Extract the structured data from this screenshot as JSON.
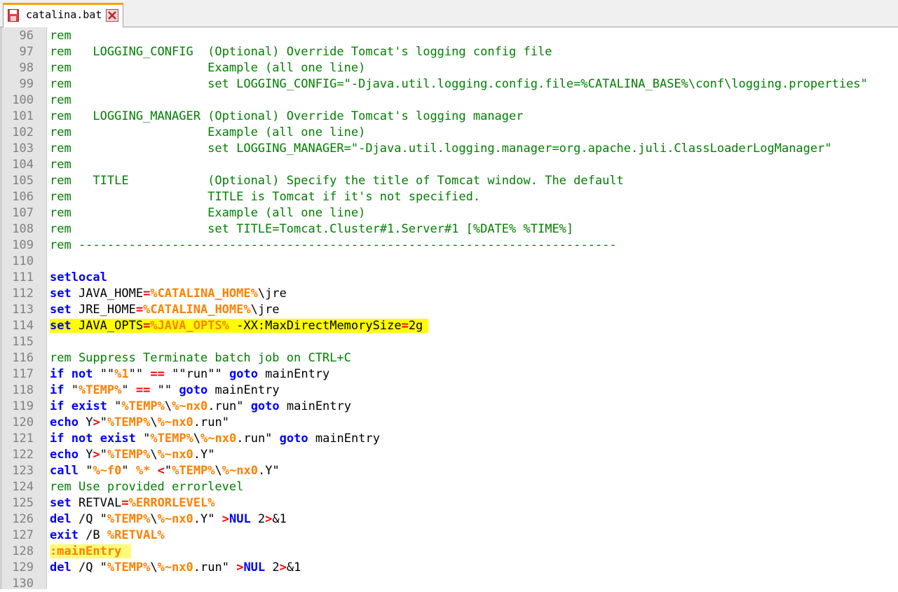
{
  "window": {
    "tab_label": "catalina.bat",
    "tab_accent_color": "#f8a000",
    "tab_icon": "save-icon",
    "tab_close_icon": "close-icon"
  },
  "colors": {
    "comment": "#008000",
    "keyword": "#0000ff",
    "variable": "#ff8000",
    "operator": "#ff0000",
    "line_highlight": "#ffff00",
    "label_highlight": "#fffa77"
  },
  "editor": {
    "lines": [
      {
        "num": "96",
        "tokens": [
          {
            "t": "rem",
            "c": "c"
          }
        ]
      },
      {
        "num": "97",
        "tokens": [
          {
            "t": "rem   LOGGING_CONFIG  (Optional) Override Tomcat's logging config file",
            "c": "c"
          }
        ]
      },
      {
        "num": "98",
        "tokens": [
          {
            "t": "rem                   Example (all one line)",
            "c": "c"
          }
        ]
      },
      {
        "num": "99",
        "tokens": [
          {
            "t": "rem                   set LOGGING_CONFIG=\"-Djava.util.logging.config.file=%CATALINA_BASE%\\conf\\logging.properties\"",
            "c": "c"
          }
        ]
      },
      {
        "num": "100",
        "tokens": [
          {
            "t": "rem",
            "c": "c"
          }
        ]
      },
      {
        "num": "101",
        "tokens": [
          {
            "t": "rem   LOGGING_MANAGER (Optional) Override Tomcat's logging manager",
            "c": "c"
          }
        ]
      },
      {
        "num": "102",
        "tokens": [
          {
            "t": "rem                   Example (all one line)",
            "c": "c"
          }
        ]
      },
      {
        "num": "103",
        "tokens": [
          {
            "t": "rem                   set LOGGING_MANAGER=\"-Djava.util.logging.manager=org.apache.juli.ClassLoaderLogManager\"",
            "c": "c"
          }
        ]
      },
      {
        "num": "104",
        "tokens": [
          {
            "t": "rem",
            "c": "c"
          }
        ]
      },
      {
        "num": "105",
        "tokens": [
          {
            "t": "rem   TITLE           (Optional) Specify the title of Tomcat window. The default",
            "c": "c"
          }
        ]
      },
      {
        "num": "106",
        "tokens": [
          {
            "t": "rem                   TITLE is Tomcat if it's not specified.",
            "c": "c"
          }
        ]
      },
      {
        "num": "107",
        "tokens": [
          {
            "t": "rem                   Example (all one line)",
            "c": "c"
          }
        ]
      },
      {
        "num": "108",
        "tokens": [
          {
            "t": "rem                   set TITLE=Tomcat.Cluster#1.Server#1 [%DATE% %TIME%]",
            "c": "c"
          }
        ]
      },
      {
        "num": "109",
        "tokens": [
          {
            "t": "rem ---------------------------------------------------------------------------",
            "c": "c"
          }
        ]
      },
      {
        "num": "110",
        "tokens": []
      },
      {
        "num": "111",
        "tokens": [
          {
            "t": "setlocal",
            "c": "k"
          }
        ]
      },
      {
        "num": "112",
        "tokens": [
          {
            "t": "set",
            "c": "k"
          },
          {
            "t": " JAVA_HOME",
            "c": "t"
          },
          {
            "t": "=",
            "c": "o"
          },
          {
            "t": "%CATALINA_HOME%",
            "c": "v"
          },
          {
            "t": "\\jre",
            "c": "t"
          }
        ]
      },
      {
        "num": "113",
        "tokens": [
          {
            "t": "set",
            "c": "k"
          },
          {
            "t": " JRE_HOME",
            "c": "t"
          },
          {
            "t": "=",
            "c": "o"
          },
          {
            "t": "%CATALINA_HOME%",
            "c": "v"
          },
          {
            "t": "\\jre",
            "c": "t"
          }
        ]
      },
      {
        "num": "114",
        "hl": "hl",
        "tokens": [
          {
            "t": "set",
            "c": "k"
          },
          {
            "t": " JAVA_OPTS",
            "c": "t"
          },
          {
            "t": "=",
            "c": "o"
          },
          {
            "t": "%JAVA_OPTS%",
            "c": "v"
          },
          {
            "t": " -XX:MaxDirectMemorySize",
            "c": "t"
          },
          {
            "t": "=",
            "c": "o"
          },
          {
            "t": "2g",
            "c": "t"
          }
        ]
      },
      {
        "num": "115",
        "tokens": []
      },
      {
        "num": "116",
        "tokens": [
          {
            "t": "rem Suppress Terminate batch job on CTRL+C",
            "c": "c"
          }
        ]
      },
      {
        "num": "117",
        "tokens": [
          {
            "t": "if",
            "c": "k"
          },
          {
            "t": " ",
            "c": "t"
          },
          {
            "t": "not",
            "c": "k"
          },
          {
            "t": " \"\"",
            "c": "t"
          },
          {
            "t": "%1",
            "c": "v"
          },
          {
            "t": "\"\" ",
            "c": "t"
          },
          {
            "t": "==",
            "c": "o"
          },
          {
            "t": " \"\"run\"\" ",
            "c": "t"
          },
          {
            "t": "goto",
            "c": "k"
          },
          {
            "t": " mainEntry",
            "c": "t"
          }
        ]
      },
      {
        "num": "118",
        "tokens": [
          {
            "t": "if",
            "c": "k"
          },
          {
            "t": " \"",
            "c": "t"
          },
          {
            "t": "%TEMP%",
            "c": "v"
          },
          {
            "t": "\" ",
            "c": "t"
          },
          {
            "t": "==",
            "c": "o"
          },
          {
            "t": " \"\" ",
            "c": "t"
          },
          {
            "t": "goto",
            "c": "k"
          },
          {
            "t": " mainEntry",
            "c": "t"
          }
        ]
      },
      {
        "num": "119",
        "tokens": [
          {
            "t": "if",
            "c": "k"
          },
          {
            "t": " ",
            "c": "t"
          },
          {
            "t": "exist",
            "c": "k"
          },
          {
            "t": " \"",
            "c": "t"
          },
          {
            "t": "%TEMP%",
            "c": "v"
          },
          {
            "t": "\\",
            "c": "t"
          },
          {
            "t": "%~nx0",
            "c": "v"
          },
          {
            "t": ".run\" ",
            "c": "t"
          },
          {
            "t": "goto",
            "c": "k"
          },
          {
            "t": " mainEntry",
            "c": "t"
          }
        ]
      },
      {
        "num": "120",
        "tokens": [
          {
            "t": "echo",
            "c": "k"
          },
          {
            "t": " Y",
            "c": "t"
          },
          {
            "t": ">",
            "c": "o"
          },
          {
            "t": "\"",
            "c": "t"
          },
          {
            "t": "%TEMP%",
            "c": "v"
          },
          {
            "t": "\\",
            "c": "t"
          },
          {
            "t": "%~nx0",
            "c": "v"
          },
          {
            "t": ".run\"",
            "c": "t"
          }
        ]
      },
      {
        "num": "121",
        "tokens": [
          {
            "t": "if",
            "c": "k"
          },
          {
            "t": " ",
            "c": "t"
          },
          {
            "t": "not",
            "c": "k"
          },
          {
            "t": " ",
            "c": "t"
          },
          {
            "t": "exist",
            "c": "k"
          },
          {
            "t": " \"",
            "c": "t"
          },
          {
            "t": "%TEMP%",
            "c": "v"
          },
          {
            "t": "\\",
            "c": "t"
          },
          {
            "t": "%~nx0",
            "c": "v"
          },
          {
            "t": ".run\" ",
            "c": "t"
          },
          {
            "t": "goto",
            "c": "k"
          },
          {
            "t": " mainEntry",
            "c": "t"
          }
        ]
      },
      {
        "num": "122",
        "tokens": [
          {
            "t": "echo",
            "c": "k"
          },
          {
            "t": " Y",
            "c": "t"
          },
          {
            "t": ">",
            "c": "o"
          },
          {
            "t": "\"",
            "c": "t"
          },
          {
            "t": "%TEMP%",
            "c": "v"
          },
          {
            "t": "\\",
            "c": "t"
          },
          {
            "t": "%~nx0",
            "c": "v"
          },
          {
            "t": ".Y\"",
            "c": "t"
          }
        ]
      },
      {
        "num": "123",
        "tokens": [
          {
            "t": "call",
            "c": "k"
          },
          {
            "t": " \"",
            "c": "t"
          },
          {
            "t": "%~f0",
            "c": "v"
          },
          {
            "t": "\" ",
            "c": "t"
          },
          {
            "t": "%*",
            "c": "v"
          },
          {
            "t": " ",
            "c": "t"
          },
          {
            "t": "<",
            "c": "o"
          },
          {
            "t": "\"",
            "c": "t"
          },
          {
            "t": "%TEMP%",
            "c": "v"
          },
          {
            "t": "\\",
            "c": "t"
          },
          {
            "t": "%~nx0",
            "c": "v"
          },
          {
            "t": ".Y\"",
            "c": "t"
          }
        ]
      },
      {
        "num": "124",
        "tokens": [
          {
            "t": "rem Use provided errorlevel",
            "c": "c"
          }
        ]
      },
      {
        "num": "125",
        "tokens": [
          {
            "t": "set",
            "c": "k"
          },
          {
            "t": " RETVAL",
            "c": "t"
          },
          {
            "t": "=",
            "c": "o"
          },
          {
            "t": "%ERRORLEVEL%",
            "c": "v"
          }
        ]
      },
      {
        "num": "126",
        "tokens": [
          {
            "t": "del",
            "c": "k"
          },
          {
            "t": " /Q \"",
            "c": "t"
          },
          {
            "t": "%TEMP%",
            "c": "v"
          },
          {
            "t": "\\",
            "c": "t"
          },
          {
            "t": "%~nx0",
            "c": "v"
          },
          {
            "t": ".Y\" ",
            "c": "t"
          },
          {
            "t": ">",
            "c": "o"
          },
          {
            "t": "NUL",
            "c": "k"
          },
          {
            "t": " 2",
            "c": "t"
          },
          {
            "t": ">",
            "c": "o"
          },
          {
            "t": "&1",
            "c": "t"
          }
        ]
      },
      {
        "num": "127",
        "tokens": [
          {
            "t": "exit",
            "c": "k"
          },
          {
            "t": " /B ",
            "c": "t"
          },
          {
            "t": "%RETVAL%",
            "c": "v"
          }
        ]
      },
      {
        "num": "128",
        "hl": "hl2",
        "tokens": [
          {
            "t": ":mainEntry",
            "c": "l"
          }
        ]
      },
      {
        "num": "129",
        "tokens": [
          {
            "t": "del",
            "c": "k"
          },
          {
            "t": " /Q \"",
            "c": "t"
          },
          {
            "t": "%TEMP%",
            "c": "v"
          },
          {
            "t": "\\",
            "c": "t"
          },
          {
            "t": "%~nx0",
            "c": "v"
          },
          {
            "t": ".run\" ",
            "c": "t"
          },
          {
            "t": ">",
            "c": "o"
          },
          {
            "t": "NUL",
            "c": "k"
          },
          {
            "t": " 2",
            "c": "t"
          },
          {
            "t": ">",
            "c": "o"
          },
          {
            "t": "&1",
            "c": "t"
          }
        ]
      },
      {
        "num": "130",
        "tokens": []
      }
    ]
  }
}
